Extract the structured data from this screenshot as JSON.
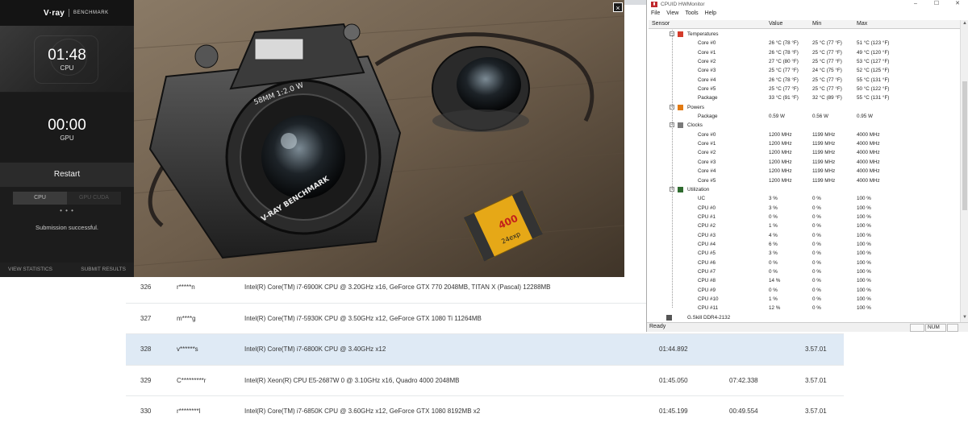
{
  "vray": {
    "logo": "V·ray",
    "header_label": "BENCHMARK",
    "cpu_time": "01:48",
    "cpu_label": "CPU",
    "gpu_time": "00:00",
    "gpu_label": "GPU",
    "restart_label": "Restart",
    "tab_cpu": "CPU",
    "tab_gpu": "GPU CUDA",
    "dots": "• • •",
    "submission_message": "Submission successful.",
    "view_statistics": "VIEW STATISTICS",
    "submit_results": "SUBMIT RESULTS"
  },
  "viewer": {
    "close_label": "×",
    "lens_text_1": "58MM 1:2.0 W",
    "lens_text_2": "V-RAY BENCHMARK",
    "film_text": "400",
    "film_text_2": "24exp"
  },
  "hwmonitor": {
    "title": "CPUID HWMonitor",
    "menu": [
      "File",
      "View",
      "Tools",
      "Help"
    ],
    "columns": {
      "sensor": "Sensor",
      "value": "Value",
      "min": "Min",
      "max": "Max"
    },
    "temperatures_label": "Temperatures",
    "temperatures": [
      {
        "name": "Core #0",
        "value": "26 °C  (78 °F)",
        "min": "25 °C  (77 °F)",
        "max": "51 °C  (123 °F)"
      },
      {
        "name": "Core #1",
        "value": "26 °C  (78 °F)",
        "min": "25 °C  (77 °F)",
        "max": "49 °C  (120 °F)"
      },
      {
        "name": "Core #2",
        "value": "27 °C  (80 °F)",
        "min": "25 °C  (77 °F)",
        "max": "53 °C  (127 °F)"
      },
      {
        "name": "Core #3",
        "value": "25 °C  (77 °F)",
        "min": "24 °C  (75 °F)",
        "max": "52 °C  (125 °F)"
      },
      {
        "name": "Core #4",
        "value": "26 °C  (78 °F)",
        "min": "25 °C  (77 °F)",
        "max": "55 °C  (131 °F)"
      },
      {
        "name": "Core #5",
        "value": "25 °C  (77 °F)",
        "min": "25 °C  (77 °F)",
        "max": "50 °C  (122 °F)"
      },
      {
        "name": "Package",
        "value": "33 °C  (91 °F)",
        "min": "32 °C  (89 °F)",
        "max": "55 °C  (131 °F)"
      }
    ],
    "powers_label": "Powers",
    "powers": [
      {
        "name": "Package",
        "value": "0.59 W",
        "min": "0.56 W",
        "max": "0.95 W"
      }
    ],
    "clocks_label": "Clocks",
    "clocks": [
      {
        "name": "Core #0",
        "value": "1200 MHz",
        "min": "1199 MHz",
        "max": "4000 MHz"
      },
      {
        "name": "Core #1",
        "value": "1200 MHz",
        "min": "1199 MHz",
        "max": "4000 MHz"
      },
      {
        "name": "Core #2",
        "value": "1200 MHz",
        "min": "1199 MHz",
        "max": "4000 MHz"
      },
      {
        "name": "Core #3",
        "value": "1200 MHz",
        "min": "1199 MHz",
        "max": "4000 MHz"
      },
      {
        "name": "Core #4",
        "value": "1200 MHz",
        "min": "1199 MHz",
        "max": "4000 MHz"
      },
      {
        "name": "Core #5",
        "value": "1200 MHz",
        "min": "1199 MHz",
        "max": "4000 MHz"
      }
    ],
    "utilization_label": "Utilization",
    "utilization": [
      {
        "name": "UC",
        "value": "3 %",
        "min": "0 %",
        "max": "100 %"
      },
      {
        "name": "CPU #0",
        "value": "3 %",
        "min": "0 %",
        "max": "100 %"
      },
      {
        "name": "CPU #1",
        "value": "0 %",
        "min": "0 %",
        "max": "100 %"
      },
      {
        "name": "CPU #2",
        "value": "1 %",
        "min": "0 %",
        "max": "100 %"
      },
      {
        "name": "CPU #3",
        "value": "4 %",
        "min": "0 %",
        "max": "100 %"
      },
      {
        "name": "CPU #4",
        "value": "6 %",
        "min": "0 %",
        "max": "100 %"
      },
      {
        "name": "CPU #5",
        "value": "3 %",
        "min": "0 %",
        "max": "100 %"
      },
      {
        "name": "CPU #6",
        "value": "0 %",
        "min": "0 %",
        "max": "100 %"
      },
      {
        "name": "CPU #7",
        "value": "0 %",
        "min": "0 %",
        "max": "100 %"
      },
      {
        "name": "CPU #8",
        "value": "14 %",
        "min": "0 %",
        "max": "100 %"
      },
      {
        "name": "CPU #9",
        "value": "0 %",
        "min": "0 %",
        "max": "100 %"
      },
      {
        "name": "CPU #10",
        "value": "1 %",
        "min": "0 %",
        "max": "100 %"
      },
      {
        "name": "CPU #11",
        "value": "12 %",
        "min": "0 %",
        "max": "100 %"
      }
    ],
    "memory_label": "G.Skill DDR4-2132",
    "status_ready": "Ready",
    "status_num": "NUM"
  },
  "results": [
    {
      "rank": "326",
      "user": "r*****n",
      "hardware": "Intel(R) Core(TM) i7-6900K CPU @ 3.20GHz x16, GeForce GTX 770 2048MB, TITAN X (Pascal) 12288MB",
      "cpu_time": "",
      "gpu_time": "",
      "version": ""
    },
    {
      "rank": "327",
      "user": "m****g",
      "hardware": "Intel(R) Core(TM) i7-5930K CPU @ 3.50GHz x12, GeForce GTX 1080 Ti 11264MB",
      "cpu_time": "",
      "gpu_time": "",
      "version": ""
    },
    {
      "rank": "328",
      "user": "v******s",
      "hardware": "Intel(R) Core(TM) i7-6800K CPU @ 3.40GHz x12",
      "cpu_time": "01:44.892",
      "gpu_time": "",
      "version": "3.57.01"
    },
    {
      "rank": "329",
      "user": "C*********r",
      "hardware": "Intel(R) Xeon(R) CPU E5-2687W 0 @ 3.10GHz x16, Quadro 4000 2048MB",
      "cpu_time": "01:45.050",
      "gpu_time": "07:42.338",
      "version": "3.57.01"
    },
    {
      "rank": "330",
      "user": "r********l",
      "hardware": "Intel(R) Core(TM) i7-6850K CPU @ 3.60GHz x12, GeForce GTX 1080 8192MB x2",
      "cpu_time": "01:45.199",
      "gpu_time": "00:49.554",
      "version": "3.57.01"
    }
  ]
}
